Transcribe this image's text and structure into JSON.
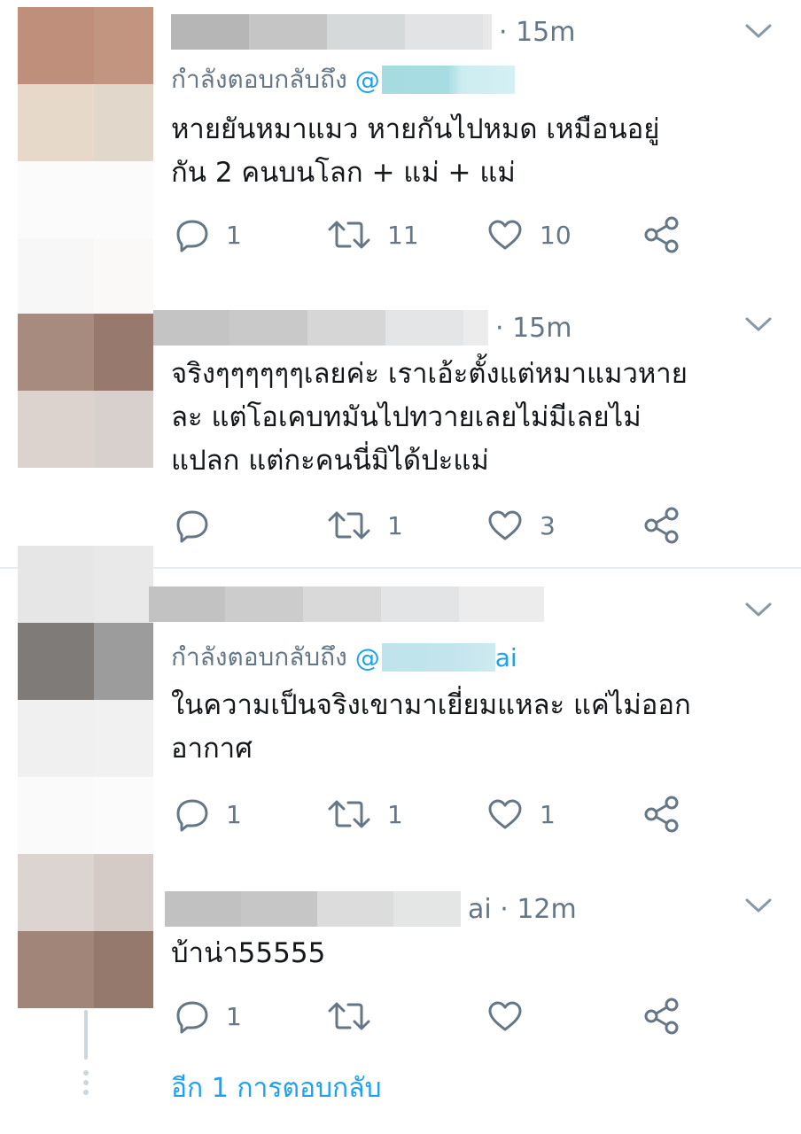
{
  "tweets": [
    {
      "time": "· 15m",
      "replying_prefix": "กำลังตอบกลับถึง",
      "replying_handle": "@",
      "text_lines": [
        "หายยันหมาแมว หายกันไปหมด เหมือนอยู่",
        "กัน 2 คนบนโลก + แม่ + แม่"
      ],
      "reply_count": "1",
      "retweet_count": "11",
      "like_count": "10"
    },
    {
      "time": "· 15m",
      "text_lines": [
        "จริงๆๆๆๆๆๆเลยค่ะ เราเอ้ะตั้งแต่หมาแมวหาย",
        "ละ แต่โอเคบทมันไปทวายเลยไม่มีเลยไม่",
        "แปลก แต่กะคนนี่มิได้ปะแม่"
      ],
      "reply_count": "",
      "retweet_count": "1",
      "like_count": "3"
    },
    {
      "time": "",
      "replying_prefix": "กำลังตอบกลับถึง",
      "replying_handle": "@",
      "replying_handle_tail": "ai",
      "text_lines": [
        "ในความเป็นจริงเขามาเยี่ยมแหละ แค่ไม่ออก",
        "อากาศ"
      ],
      "reply_count": "1",
      "retweet_count": "1",
      "like_count": "1"
    },
    {
      "time": "ai · 12m",
      "text_lines": [
        "บ้าน่า55555"
      ],
      "reply_count": "1",
      "retweet_count": "",
      "like_count": ""
    }
  ],
  "show_more_replies": "อีก 1 การตอบกลับ",
  "icons": {
    "reply": "reply-icon",
    "retweet": "retweet-icon",
    "like": "heart-icon",
    "share": "share-icon",
    "menu": "chevron-down-icon"
  },
  "colors": {
    "accent": "#1da1f2",
    "muted": "#657786",
    "text": "#14171a",
    "divider": "#e6ecf0"
  }
}
